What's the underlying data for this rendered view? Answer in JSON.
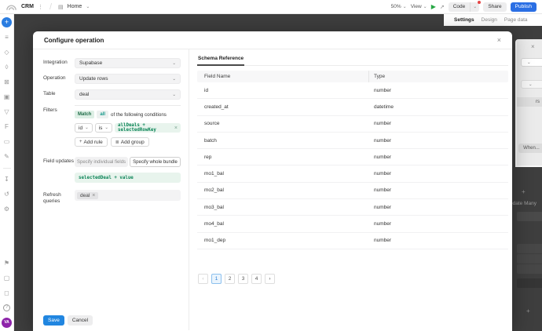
{
  "topbar": {
    "app_name": "CRM",
    "page_name": "Home",
    "zoom_level": "50%",
    "view_label": "View",
    "code_label": "Code",
    "share_label": "Share",
    "publish_label": "Publish"
  },
  "right_tabs": {
    "settings": "Settings",
    "design": "Design",
    "page_data": "Page data"
  },
  "background_panel": {
    "cut_button_fragment": "rs",
    "when_label": "When...",
    "update_many_fragment": "pdate Many"
  },
  "modal": {
    "title": "Configure operation",
    "integration": {
      "label": "Integration",
      "value": "Supabase"
    },
    "operation": {
      "label": "Operation",
      "value": "Update rows"
    },
    "table": {
      "label": "Table",
      "value": "deal"
    },
    "filters": {
      "label": "Filters",
      "match_label": "Match",
      "match_mode": "all",
      "match_suffix": "of the following conditions",
      "condition_field": "id",
      "condition_operator": "is",
      "condition_value": "allDeals + selectedRowKey",
      "add_rule_label": "Add rule",
      "add_group_label": "Add group"
    },
    "field_updates": {
      "label": "Field updates",
      "option_individual": "Specify individual fields",
      "option_bundle": "Specify whole bundle",
      "bundle_value": "selectedDeal + value"
    },
    "refresh_queries": {
      "label": "Refresh queries",
      "tag": "deal"
    },
    "save_label": "Save",
    "cancel_label": "Cancel"
  },
  "schema": {
    "tab_label": "Schema Reference",
    "columns": [
      "Field Name",
      "Type"
    ],
    "rows": [
      [
        "id",
        "number"
      ],
      [
        "created_at",
        "datetime"
      ],
      [
        "source",
        "number"
      ],
      [
        "batch",
        "number"
      ],
      [
        "rep",
        "number"
      ],
      [
        "mo1_bal",
        "number"
      ],
      [
        "mo2_bal",
        "number"
      ],
      [
        "mo3_bal",
        "number"
      ],
      [
        "mo4_bal",
        "number"
      ],
      [
        "mo1_dep",
        "number"
      ]
    ],
    "pagination": {
      "pages": [
        "1",
        "2",
        "3",
        "4"
      ],
      "active": "1"
    }
  },
  "sidebar": {
    "avatar_initials": "VA"
  },
  "icons": {
    "caret_down": "⌄",
    "close": "×",
    "remove": "×",
    "play": "▶",
    "external_link": "↗",
    "kebab": "⋮",
    "page": "▤",
    "plus": "+",
    "chevron_left": "‹",
    "chevron_right": "›",
    "add_group_glyph": "≣",
    "help": "?",
    "sidebar_glyphs": [
      "≡",
      "◇",
      "◊",
      "⊠",
      "▣",
      "▽",
      "F",
      "▭",
      "✎",
      "↧",
      "↺",
      "⚙",
      "⚑",
      "▢",
      "◻"
    ]
  },
  "colors": {
    "accent_blue": "#2b6fe4",
    "save_blue": "#2186e0",
    "code_green": "#0b8457",
    "backdrop": "#3e3e3e",
    "avatar_purple": "#8e24aa",
    "notification_red": "#e54545"
  }
}
